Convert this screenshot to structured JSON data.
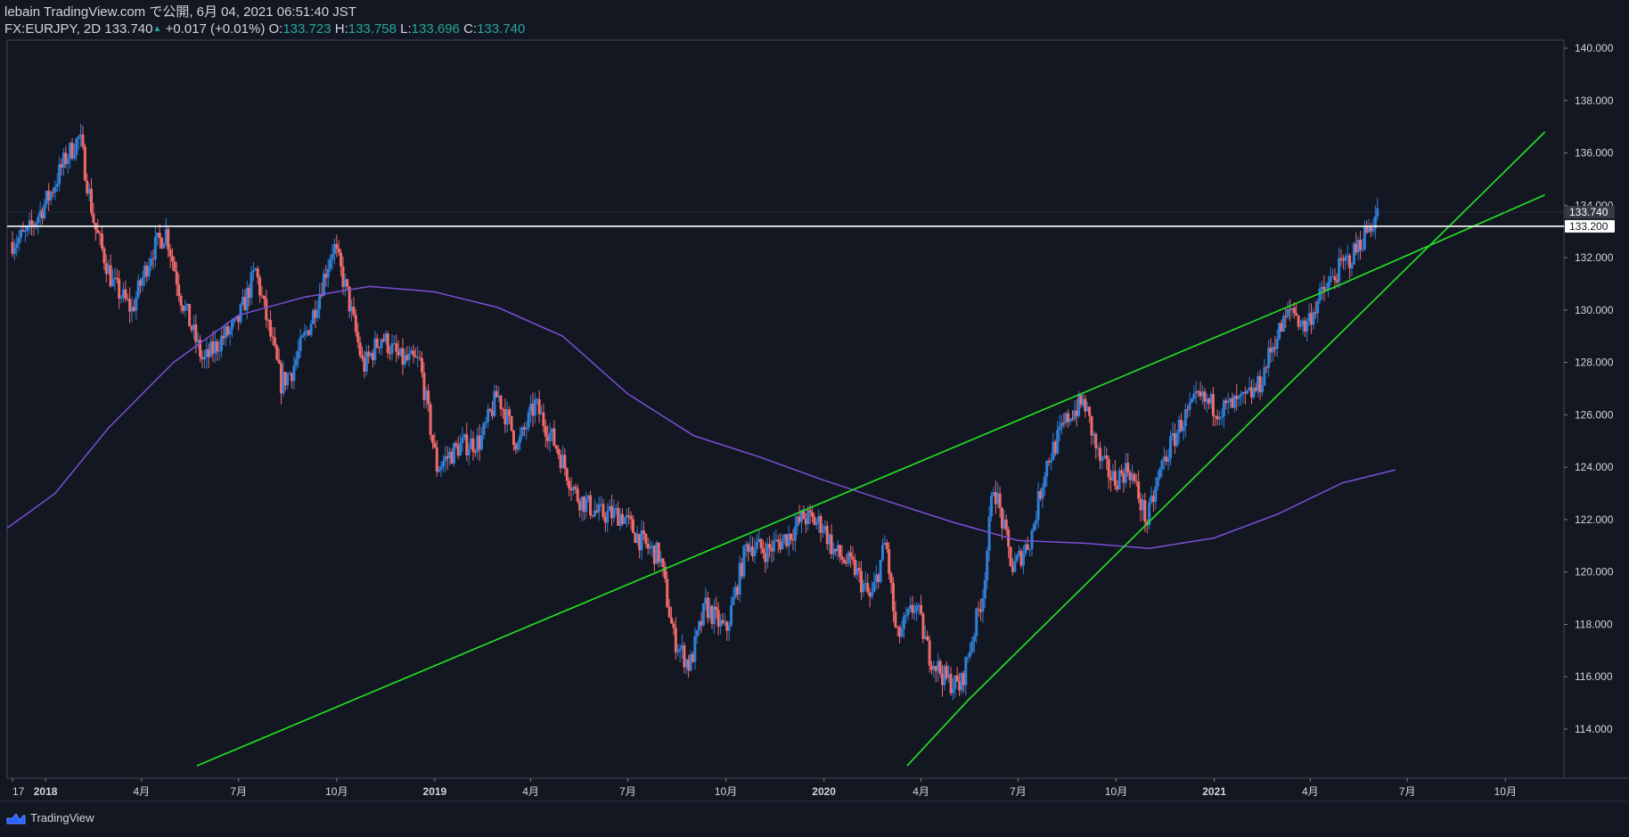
{
  "header": {
    "line1": "lebain TradingView.com で公開, 6月 04, 2021 06:51:40 JST",
    "symbol": "FX:EURJPY, 2D",
    "last": "133.740",
    "change": "+0.017 (+0.01%)",
    "o_label": "O:",
    "o_value": "133.723",
    "h_label": "H:",
    "h_value": "133.758",
    "l_label": "L:",
    "l_value": "133.696",
    "c_label": "C:",
    "c_value": "133.740"
  },
  "footer": {
    "brand": "TradingView",
    "logo_icon": "tradingview-logo-icon"
  },
  "colors": {
    "background": "#131722",
    "up": "#2f7fd8",
    "down": "#ef6a6a",
    "ma": "#7b4fd6",
    "trendline": "#22e622",
    "level": "#ffffff",
    "axis_text": "#d1d4dc"
  },
  "chart_data": {
    "type": "candlestick",
    "symbol": "FX:EURJPY",
    "interval": "2D",
    "y_range": [
      112.5,
      140.5
    ],
    "x_range": [
      "2017-12-25",
      "2021-11-07"
    ],
    "y_ticks": [
      "114.000",
      "116.000",
      "118.000",
      "120.000",
      "122.000",
      "124.000",
      "126.000",
      "128.000",
      "130.000",
      "132.000",
      "134.000",
      "136.000",
      "138.000",
      "140.000"
    ],
    "x_ticks": [
      {
        "date": "2017-12-01",
        "label": "17"
      },
      {
        "date": "2018-01-01",
        "label": "2018"
      },
      {
        "date": "2018-04-01",
        "label": "4月"
      },
      {
        "date": "2018-07-01",
        "label": "7月"
      },
      {
        "date": "2018-10-01",
        "label": "10月"
      },
      {
        "date": "2019-01-01",
        "label": "2019"
      },
      {
        "date": "2019-04-01",
        "label": "4月"
      },
      {
        "date": "2019-07-01",
        "label": "7月"
      },
      {
        "date": "2019-10-01",
        "label": "10月"
      },
      {
        "date": "2020-01-01",
        "label": "2020"
      },
      {
        "date": "2020-04-01",
        "label": "4月"
      },
      {
        "date": "2020-07-01",
        "label": "7月"
      },
      {
        "date": "2020-10-01",
        "label": "10月"
      },
      {
        "date": "2021-01-01",
        "label": "2021"
      },
      {
        "date": "2021-04-01",
        "label": "4月"
      },
      {
        "date": "2021-07-01",
        "label": "7月"
      },
      {
        "date": "2021-10-01",
        "label": "10月"
      }
    ],
    "price_path": [
      [
        "2017-12-01",
        132.6
      ],
      [
        "2017-12-15",
        132.9
      ],
      [
        "2018-01-05",
        134.4
      ],
      [
        "2018-01-20",
        135.8
      ],
      [
        "2018-02-02",
        136.6
      ],
      [
        "2018-02-16",
        133.2
      ],
      [
        "2018-03-05",
        131.0
      ],
      [
        "2018-03-23",
        130.0
      ],
      [
        "2018-04-10",
        132.2
      ],
      [
        "2018-04-24",
        133.0
      ],
      [
        "2018-05-08",
        130.5
      ],
      [
        "2018-05-29",
        128.0
      ],
      [
        "2018-06-15",
        128.9
      ],
      [
        "2018-06-29",
        129.4
      ],
      [
        "2018-07-17",
        131.5
      ],
      [
        "2018-08-10",
        127.2
      ],
      [
        "2018-08-20",
        127.7
      ],
      [
        "2018-09-07",
        129.6
      ],
      [
        "2018-09-28",
        132.5
      ],
      [
        "2018-10-11",
        130.6
      ],
      [
        "2018-10-26",
        127.8
      ],
      [
        "2018-11-12",
        129.0
      ],
      [
        "2018-11-30",
        128.1
      ],
      [
        "2018-12-18",
        128.0
      ],
      [
        "2019-01-03",
        124.0
      ],
      [
        "2019-01-24",
        124.8
      ],
      [
        "2019-02-13",
        125.0
      ],
      [
        "2019-03-01",
        126.8
      ],
      [
        "2019-03-20",
        124.8
      ],
      [
        "2019-04-05",
        126.4
      ],
      [
        "2019-04-26",
        124.7
      ],
      [
        "2019-05-14",
        122.9
      ],
      [
        "2019-06-04",
        122.2
      ],
      [
        "2019-06-25",
        122.2
      ],
      [
        "2019-07-17",
        121.0
      ],
      [
        "2019-07-31",
        120.6
      ],
      [
        "2019-08-13",
        117.5
      ],
      [
        "2019-08-28",
        116.4
      ],
      [
        "2019-09-12",
        118.7
      ],
      [
        "2019-10-01",
        117.7
      ],
      [
        "2019-10-21",
        121.1
      ],
      [
        "2019-11-08",
        120.8
      ],
      [
        "2019-11-29",
        121.4
      ],
      [
        "2019-12-13",
        122.1
      ],
      [
        "2019-12-31",
        121.8
      ],
      [
        "2020-01-10",
        120.8
      ],
      [
        "2020-01-30",
        120.1
      ],
      [
        "2020-02-14",
        118.9
      ],
      [
        "2020-02-28",
        121.2
      ],
      [
        "2020-03-09",
        117.4
      ],
      [
        "2020-03-27",
        118.8
      ],
      [
        "2020-04-08",
        116.9
      ],
      [
        "2020-04-24",
        115.9
      ],
      [
        "2020-05-08",
        115.6
      ],
      [
        "2020-05-29",
        119.2
      ],
      [
        "2020-06-08",
        123.4
      ],
      [
        "2020-06-26",
        120.1
      ],
      [
        "2020-07-13",
        121.3
      ],
      [
        "2020-07-27",
        124.1
      ],
      [
        "2020-08-18",
        126.0
      ],
      [
        "2020-09-01",
        126.5
      ],
      [
        "2020-09-15",
        124.3
      ],
      [
        "2020-09-29",
        123.5
      ],
      [
        "2020-10-13",
        124.0
      ],
      [
        "2020-10-30",
        121.9
      ],
      [
        "2020-11-13",
        124.1
      ],
      [
        "2020-12-01",
        125.7
      ],
      [
        "2020-12-17",
        126.6
      ],
      [
        "2021-01-08",
        126.2
      ],
      [
        "2021-01-28",
        126.5
      ],
      [
        "2021-02-12",
        127.1
      ],
      [
        "2021-02-26",
        128.8
      ],
      [
        "2021-03-15",
        130.1
      ],
      [
        "2021-03-26",
        129.3
      ],
      [
        "2021-04-09",
        130.4
      ],
      [
        "2021-04-27",
        131.5
      ],
      [
        "2021-05-11",
        132.1
      ],
      [
        "2021-05-25",
        133.1
      ],
      [
        "2021-06-04",
        133.74
      ]
    ],
    "series": [
      {
        "name": "",
        "type": "moving_average",
        "color": "#7b4fd6",
        "points": [
          [
            "2017-11-20",
            121.5
          ],
          [
            "2018-01-10",
            123.0
          ],
          [
            "2018-03-01",
            125.5
          ],
          [
            "2018-05-01",
            128.0
          ],
          [
            "2018-07-01",
            129.8
          ],
          [
            "2018-09-01",
            130.5
          ],
          [
            "2018-11-01",
            130.9
          ],
          [
            "2018-12-31",
            130.7
          ],
          [
            "2019-03-01",
            130.1
          ],
          [
            "2019-05-01",
            129.0
          ],
          [
            "2019-07-01",
            126.8
          ],
          [
            "2019-09-01",
            125.2
          ],
          [
            "2019-11-01",
            124.4
          ],
          [
            "2020-01-01",
            123.5
          ],
          [
            "2020-03-01",
            122.7
          ],
          [
            "2020-05-01",
            121.9
          ],
          [
            "2020-07-01",
            121.2
          ],
          [
            "2020-09-01",
            121.1
          ],
          [
            "2020-11-01",
            120.9
          ],
          [
            "2021-01-01",
            121.3
          ],
          [
            "2021-03-01",
            122.2
          ],
          [
            "2021-05-01",
            123.4
          ],
          [
            "2021-06-20",
            123.9
          ]
        ]
      },
      {
        "name": "",
        "type": "trendline",
        "color": "#22e622",
        "points": [
          [
            "2018-05-23",
            112.6
          ],
          [
            "2021-05-01",
            131.0
          ],
          [
            "2021-11-07",
            134.4
          ]
        ]
      },
      {
        "name": "",
        "type": "trendline",
        "color": "#22e622",
        "points": [
          [
            "2020-03-19",
            112.6
          ],
          [
            "2020-05-15",
            115.1
          ],
          [
            "2021-11-07",
            136.8
          ]
        ]
      },
      {
        "name": "",
        "type": "horizontal_line",
        "color": "#ffffff",
        "value": 133.2
      }
    ],
    "price_labels": [
      {
        "value": 133.74,
        "text": "133.740",
        "style": "last"
      },
      {
        "value": 133.2,
        "text": "133.200",
        "style": "level"
      }
    ]
  }
}
